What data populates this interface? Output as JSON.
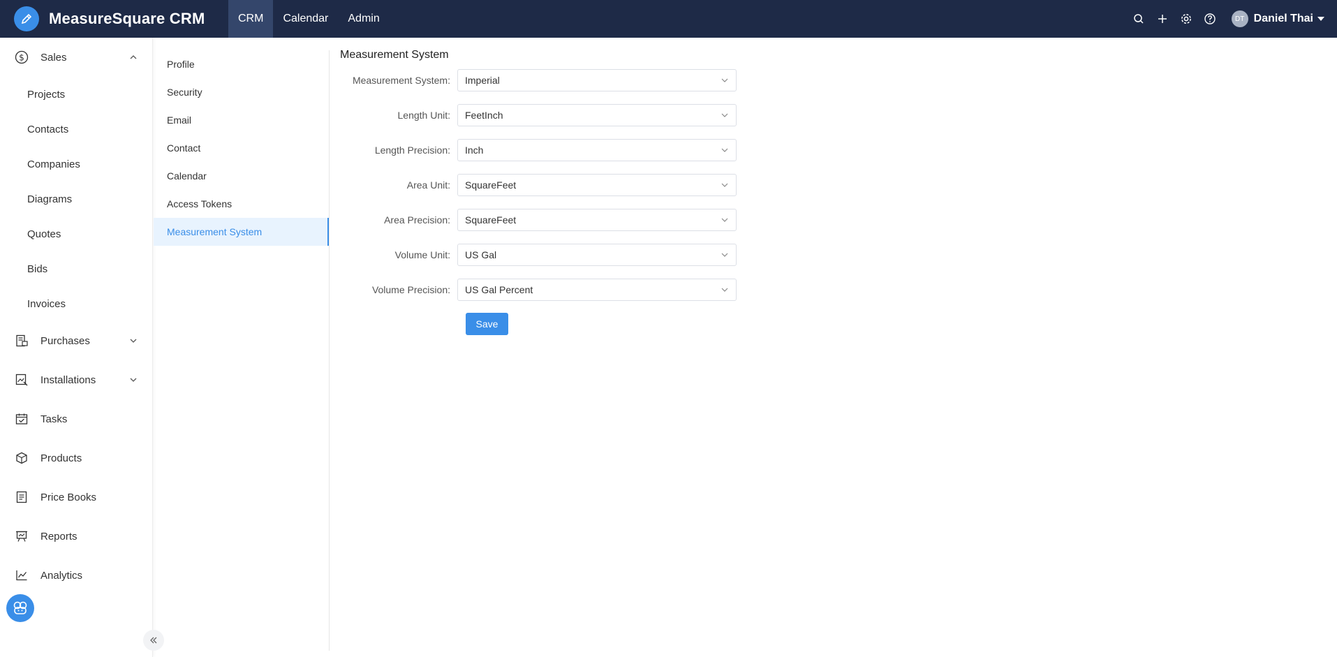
{
  "app": {
    "name": "MeasureSquare CRM",
    "brand_color": "#3a8ee8",
    "topbar_color": "#1e2a47"
  },
  "topnav": [
    {
      "label": "CRM",
      "active": true
    },
    {
      "label": "Calendar",
      "active": false
    },
    {
      "label": "Admin",
      "active": false
    }
  ],
  "user": {
    "initials": "DT",
    "name": "Daniel Thai"
  },
  "sidebar": {
    "sales": "Sales",
    "sales_items": [
      "Projects",
      "Contacts",
      "Companies",
      "Diagrams",
      "Quotes",
      "Bids",
      "Invoices"
    ],
    "purchases": "Purchases",
    "installations": "Installations",
    "tasks": "Tasks",
    "products": "Products",
    "price_books": "Price Books",
    "reports": "Reports",
    "analytics": "Analytics"
  },
  "settings_menu": [
    "Profile",
    "Security",
    "Email",
    "Contact",
    "Calendar",
    "Access Tokens",
    "Measurement System"
  ],
  "form": {
    "title": "Measurement System",
    "fields": [
      {
        "label": "Measurement System:",
        "value": "Imperial"
      },
      {
        "label": "Length Unit:",
        "value": "FeetInch"
      },
      {
        "label": "Length Precision:",
        "value": "Inch"
      },
      {
        "label": "Area Unit:",
        "value": "SquareFeet"
      },
      {
        "label": "Area Precision:",
        "value": "SquareFeet"
      },
      {
        "label": "Volume Unit:",
        "value": "US Gal"
      },
      {
        "label": "Volume Precision:",
        "value": "US Gal Percent"
      }
    ],
    "save_label": "Save"
  }
}
